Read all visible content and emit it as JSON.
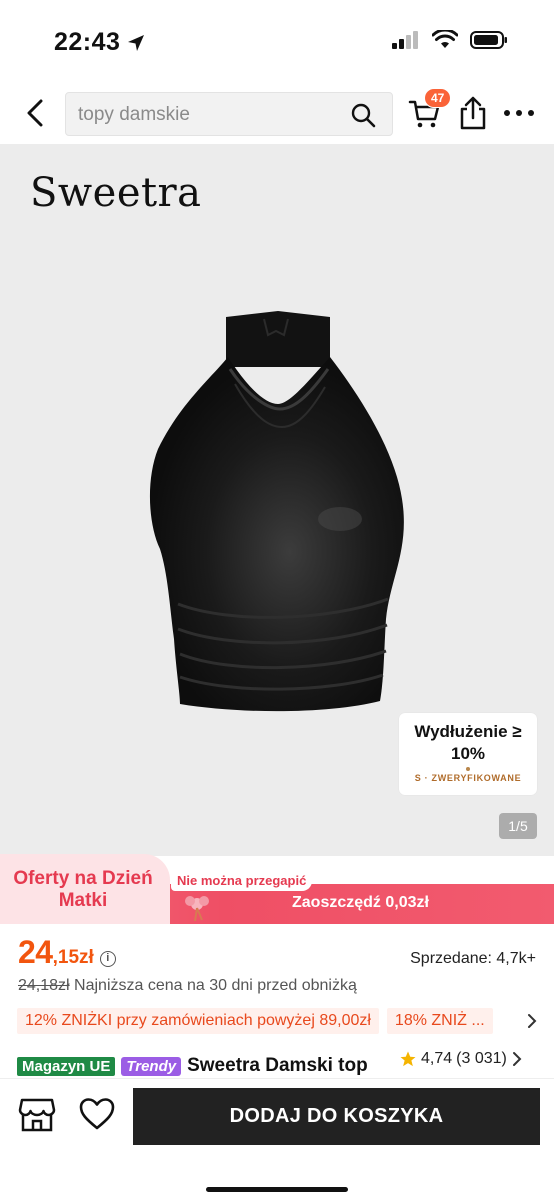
{
  "status_bar": {
    "time": "22:43"
  },
  "header": {
    "search_placeholder": "topy damskie",
    "cart_count": "47"
  },
  "hero": {
    "brand": "Sweetra",
    "elongation_line1": "Wydłużenie ≥",
    "elongation_line2": "10%",
    "elongation_verified": "S · ZWERYFIKOWANE",
    "pager": "1/5"
  },
  "promo": {
    "title": "Oferty na Dzień Matki",
    "chip": "Nie można przegapić",
    "savings": "Zaoszczędź 0,03zł"
  },
  "price": {
    "main": "24",
    "cents": ",15zł",
    "sold": "Sprzedane: 4,7k+",
    "old_price": "24,18zł",
    "lowest_note": " Najniższa cena na 30 dni przed obniżką"
  },
  "coupons": [
    {
      "label": "12% ZNIŻKI przy zamówieniach powyżej 89,00zł"
    },
    {
      "label": "18% ZNIŻ ..."
    }
  ],
  "product": {
    "tag_ue": "Magazyn UE",
    "tag_trendy": "Trendy",
    "title": "Sweetra Damski top",
    "rating": "4,74",
    "reviews": "(3 031)"
  },
  "bottom_bar": {
    "add_to_cart": "DODAJ DO KOSZYKA"
  },
  "colors": {
    "accent": "#f2550e",
    "promo_red": "#ef4f65",
    "badge": "#fa6338",
    "button": "#222222"
  }
}
